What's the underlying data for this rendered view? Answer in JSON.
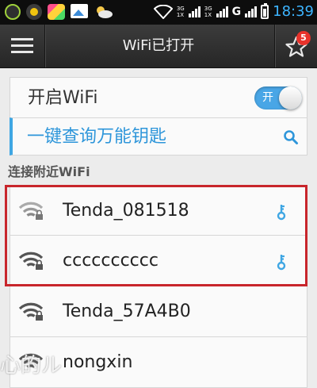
{
  "status_bar": {
    "time": "18:39",
    "network_type": "G",
    "sig1_top": "3G",
    "sig1_bottom": "1X",
    "sig2_top": "3G",
    "sig2_bottom": "1X",
    "notification_icons": [
      "wechat-icon",
      "qq-icon",
      "appstore-icon",
      "gallery-icon",
      "weather-icon"
    ],
    "battery_level": 0.6
  },
  "header": {
    "title": "WiFi已打开",
    "star_badge": "5"
  },
  "wifi_switch": {
    "label": "开启WiFi",
    "toggle_text": "开",
    "on": true
  },
  "query": {
    "label": "一键查询万能钥匙"
  },
  "section": {
    "label": "连接附近WiFi"
  },
  "networks": [
    {
      "name": "Tenda_081518",
      "has_key": true,
      "signal": "strong"
    },
    {
      "name": "cccccccccc",
      "has_key": true,
      "signal": "strong"
    },
    {
      "name": "Tenda_57A4B0",
      "has_key": false,
      "signal": "strong"
    },
    {
      "name": "nongxin",
      "has_key": false,
      "signal": "strong"
    }
  ],
  "watermark": "心的ル",
  "colors": {
    "accent": "#3fa6e3",
    "highlight": "#c8252b",
    "time": "#3db4ff",
    "badge": "#e8322b"
  }
}
